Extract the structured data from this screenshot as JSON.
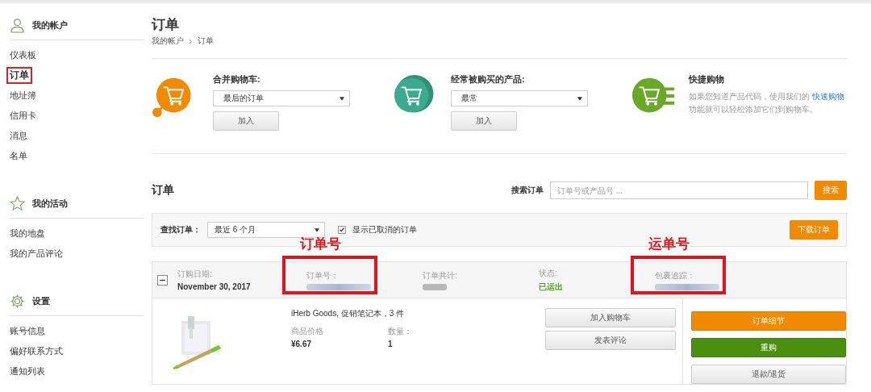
{
  "sidebar": {
    "sections": [
      {
        "title": "我的帐户",
        "items": [
          {
            "label": "仪表板",
            "selected": false
          },
          {
            "label": "订单",
            "selected": true
          },
          {
            "label": "地址簿",
            "selected": false
          },
          {
            "label": "信用卡",
            "selected": false
          },
          {
            "label": "消息",
            "selected": false
          },
          {
            "label": "名单",
            "selected": false
          }
        ]
      },
      {
        "title": "我的活动",
        "items": [
          {
            "label": "我的地盘",
            "selected": false
          },
          {
            "label": "我的产品评论",
            "selected": false
          }
        ]
      },
      {
        "title": "设置",
        "items": [
          {
            "label": "账号信息",
            "selected": false
          },
          {
            "label": "偏好联系方式",
            "selected": false
          },
          {
            "label": "通知列表",
            "selected": false
          }
        ]
      }
    ]
  },
  "page": {
    "title": "订单",
    "breadcrumb": [
      "我的帐户",
      "订单"
    ]
  },
  "promos": [
    {
      "kind": "merge",
      "label": "合并购物车:",
      "select": "最后的订单",
      "button": "加入"
    },
    {
      "kind": "frequent",
      "label": "经常被购买的产品:",
      "select": "最常",
      "button": "加入"
    },
    {
      "kind": "quick",
      "label": "快捷购物",
      "text_before": "如果您知道产品代码，使用我们的 ",
      "link": "快速购物",
      "text_after": "功能就可以轻松添加它们到购物车。"
    }
  ],
  "orders": {
    "title": "订单",
    "search_label": "搜索订单",
    "search": {
      "placeholder": "订单号或产品号 ..."
    },
    "search_button": "搜索",
    "filter": {
      "label": "查找订单：",
      "select": "最近 6 个月",
      "checkbox": {
        "label": "显示已取消的订单",
        "checked": true
      },
      "button": "下载订单"
    },
    "order": {
      "expanded": true,
      "fields": [
        {
          "label": "订购日期:",
          "value": "November 30, 2017"
        },
        {
          "label": "订单号：",
          "redacted": true,
          "annotation": "订单号"
        },
        {
          "label": "订单共计:",
          "redacted": true
        },
        {
          "label": "状态:",
          "value": "已运出",
          "kind": "status"
        },
        {
          "label": "包裹追踪：",
          "redacted": true,
          "annotation": "运单号"
        }
      ],
      "item": {
        "name": "iHerb Goods, 促销笔记本，3 件",
        "price_label": "商品价格",
        "price": "¥6.67",
        "qty_label": "数量：",
        "qty": "1",
        "buttons": [
          "加入购物车",
          "发表评论"
        ]
      },
      "actions": [
        {
          "label": "订单细节",
          "kind": "primary"
        },
        {
          "label": "重购",
          "kind": "success"
        },
        {
          "label": "退款/退货",
          "kind": "default"
        }
      ]
    }
  }
}
